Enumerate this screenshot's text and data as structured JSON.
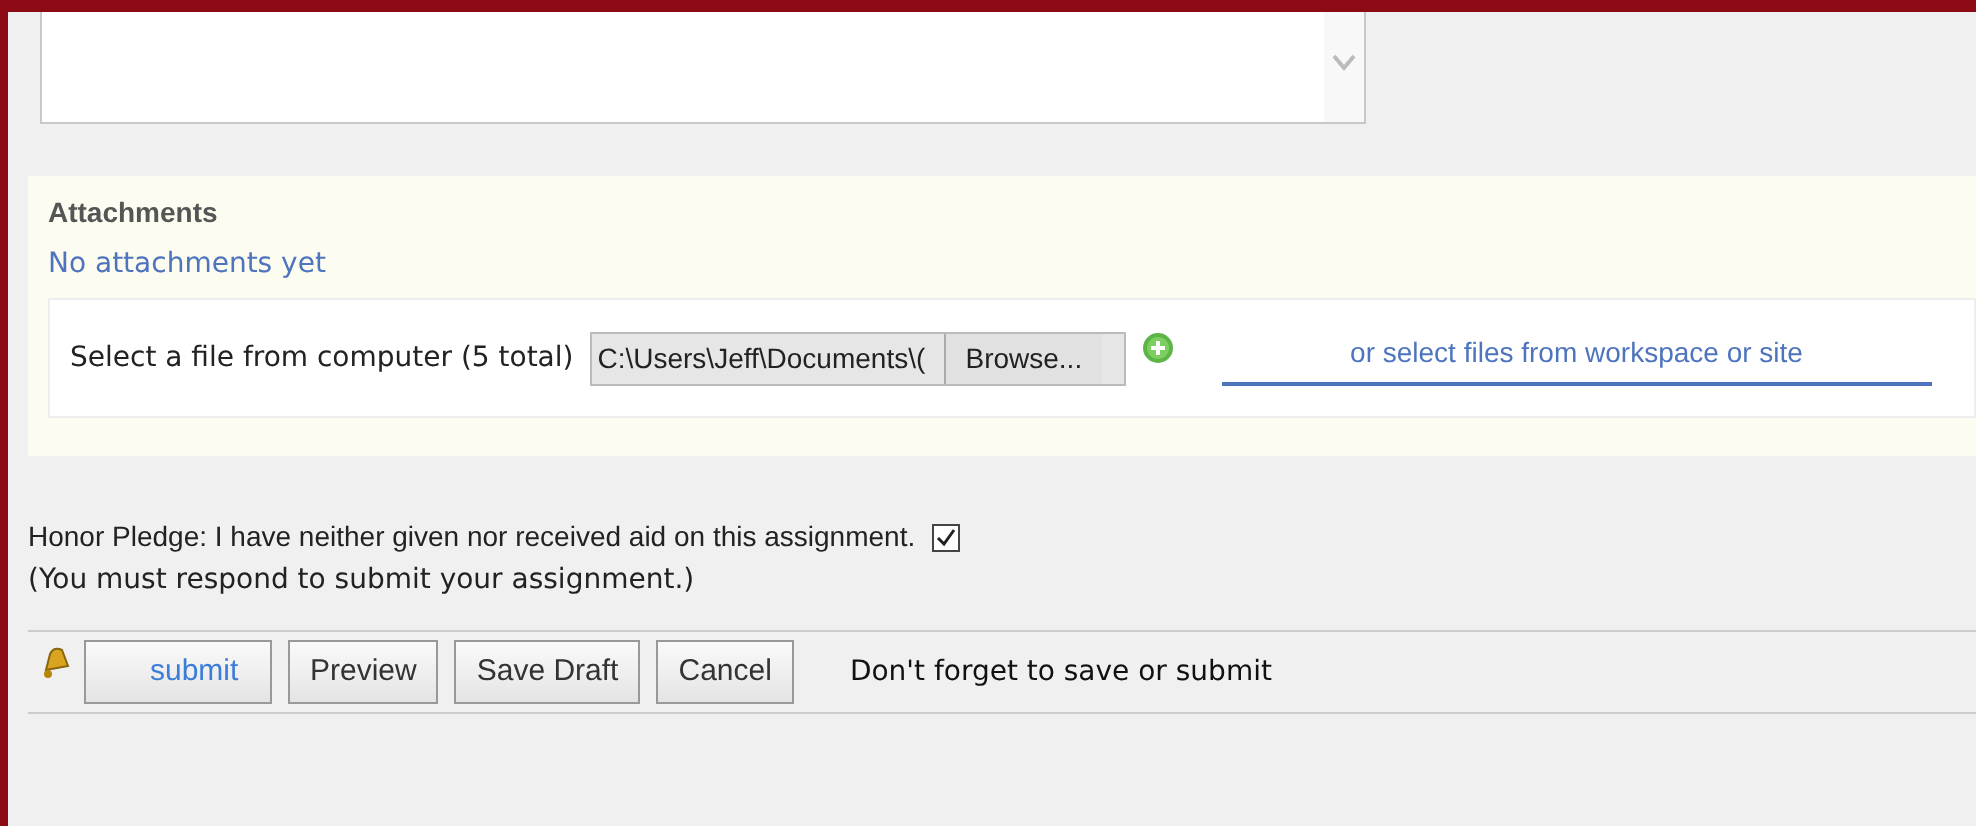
{
  "attachments": {
    "title": "Attachments",
    "status": "No attachments yet",
    "file_label": "Select a file from computer (5 total)",
    "file_value": "C:\\Users\\Jeff\\Documents\\(",
    "browse": "Browse...",
    "workspace_link": "or select files from workspace or site"
  },
  "honor_pledge": {
    "text": "Honor Pledge: I have neither given nor received aid on this assignment.",
    "checked": true,
    "note": "(You must respond to submit your assignment.)"
  },
  "buttons": [
    {
      "label": "submit",
      "kind": "primary"
    },
    {
      "label": "Preview",
      "kind": "plain"
    },
    {
      "label": "Save Draft",
      "kind": "plain"
    },
    {
      "label": "Cancel",
      "kind": "plain"
    }
  ],
  "reminder": "Don't forget to save or submit"
}
